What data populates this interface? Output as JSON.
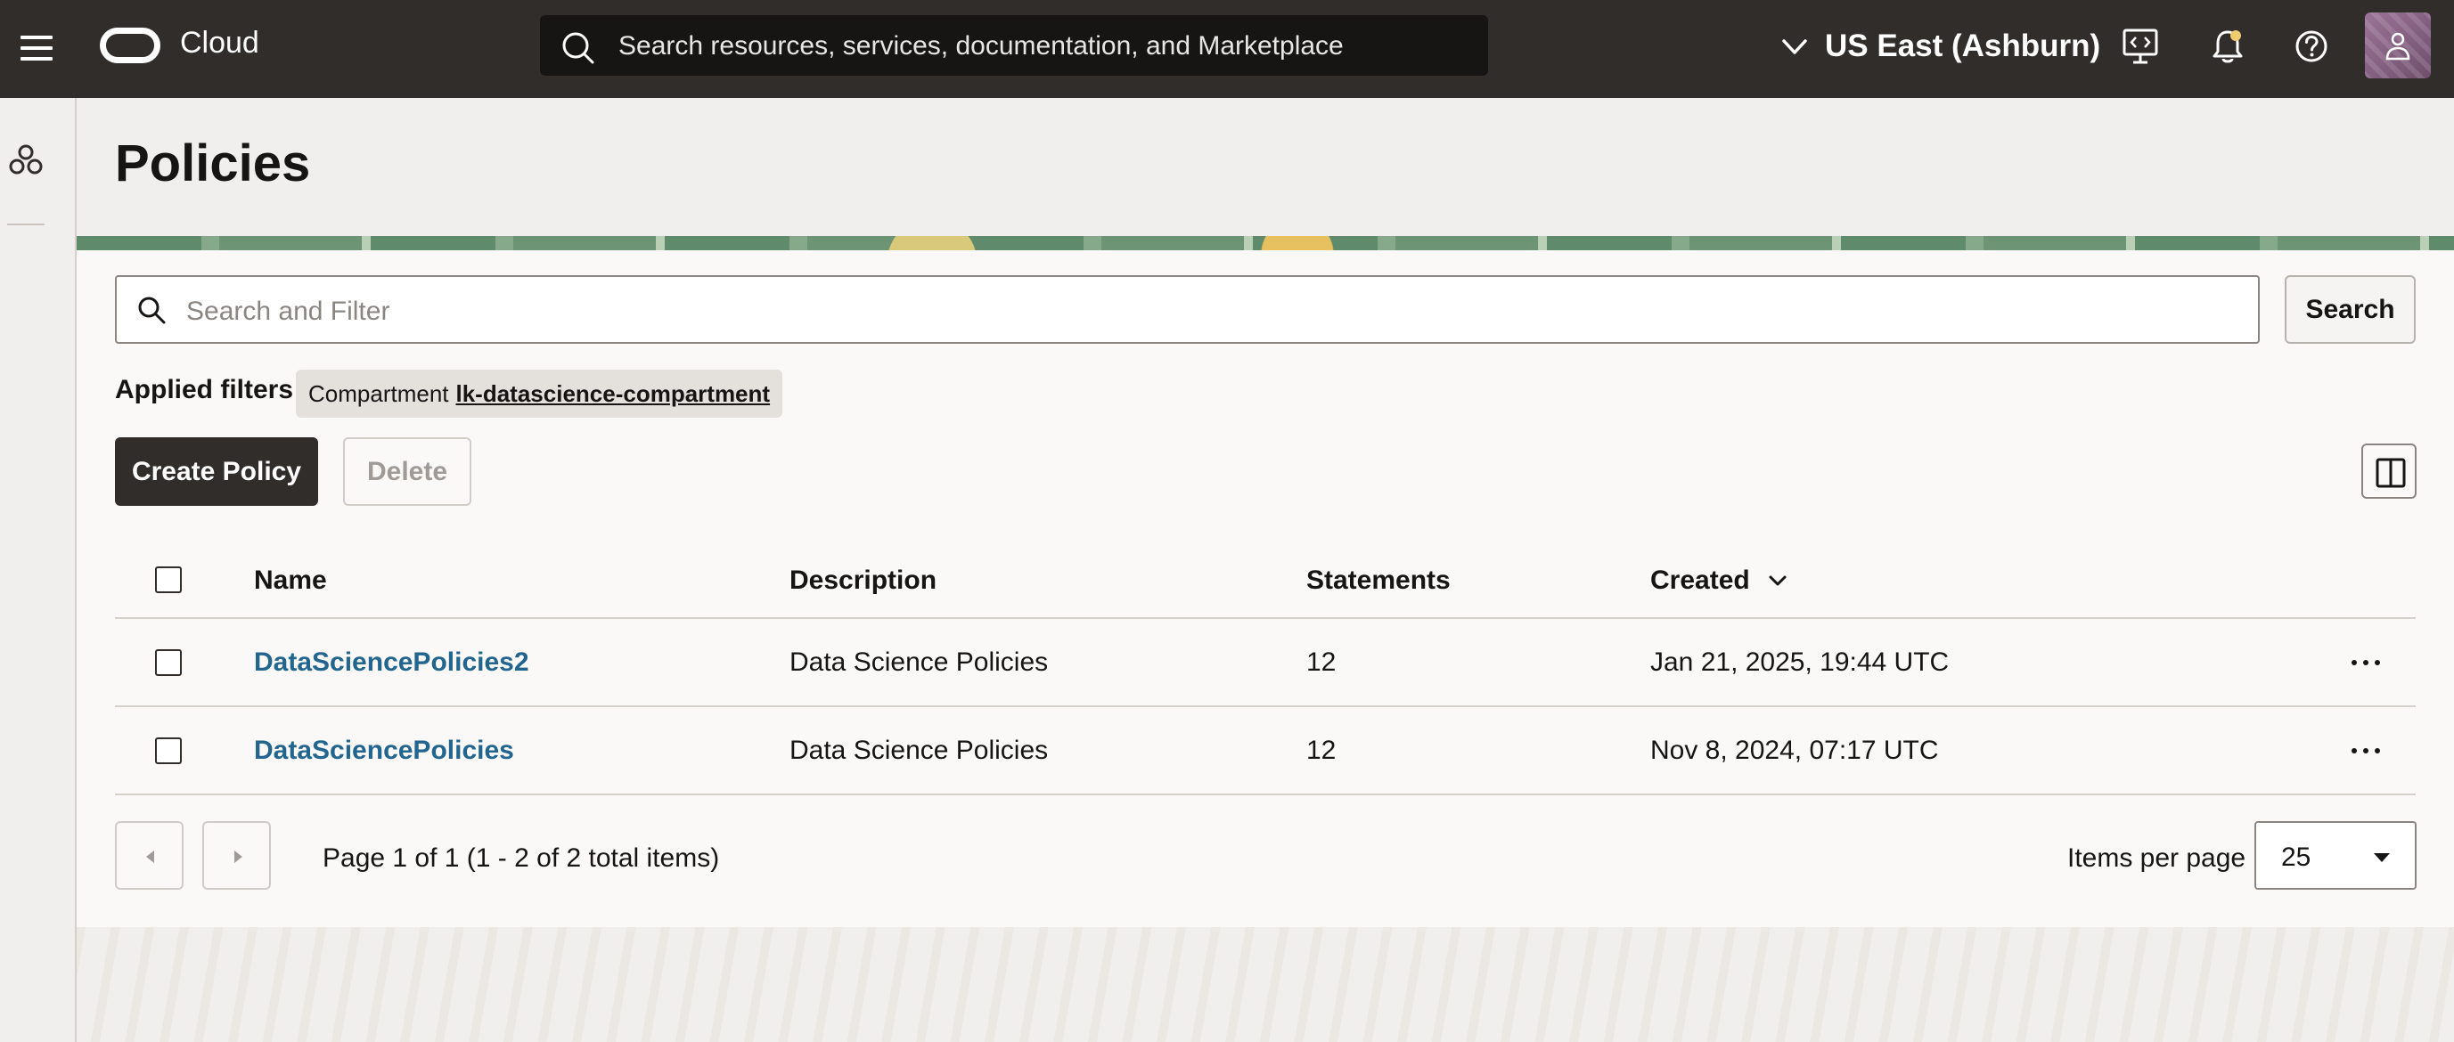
{
  "header": {
    "brand": "Cloud",
    "search_placeholder": "Search resources, services, documentation, and Marketplace",
    "region": "US East (Ashburn)",
    "icons": [
      "menu-icon",
      "search-icon",
      "chevron-down-icon",
      "developer-tools-icon",
      "bell-icon",
      "help-icon",
      "user-icon"
    ]
  },
  "page": {
    "title": "Policies"
  },
  "toolbar": {
    "filter_placeholder": "Search and Filter",
    "search_label": "Search",
    "applied_filters_label": "Applied filters",
    "filter_chip_key": "Compartment",
    "filter_chip_value": "lk-datascience-compartment",
    "create_label": "Create Policy",
    "delete_label": "Delete"
  },
  "table": {
    "columns": [
      "Name",
      "Description",
      "Statements",
      "Created"
    ],
    "rows": [
      {
        "name": "DataSciencePolicies2",
        "description": "Data Science Policies",
        "statements": "12",
        "created": "Jan 21, 2025, 19:44 UTC"
      },
      {
        "name": "DataSciencePolicies",
        "description": "Data Science Policies",
        "statements": "12",
        "created": "Nov 8, 2024, 07:17 UTC"
      }
    ]
  },
  "pagination": {
    "summary": "Page 1 of 1 (1 - 2 of 2 total items)",
    "items_per_page_label": "Items per page",
    "items_per_page_value": "25"
  },
  "colors": {
    "header_bg": "#312d2a",
    "link": "#22668f",
    "primary_button": "#312d2a",
    "notification_dot": "#f0cc71"
  }
}
